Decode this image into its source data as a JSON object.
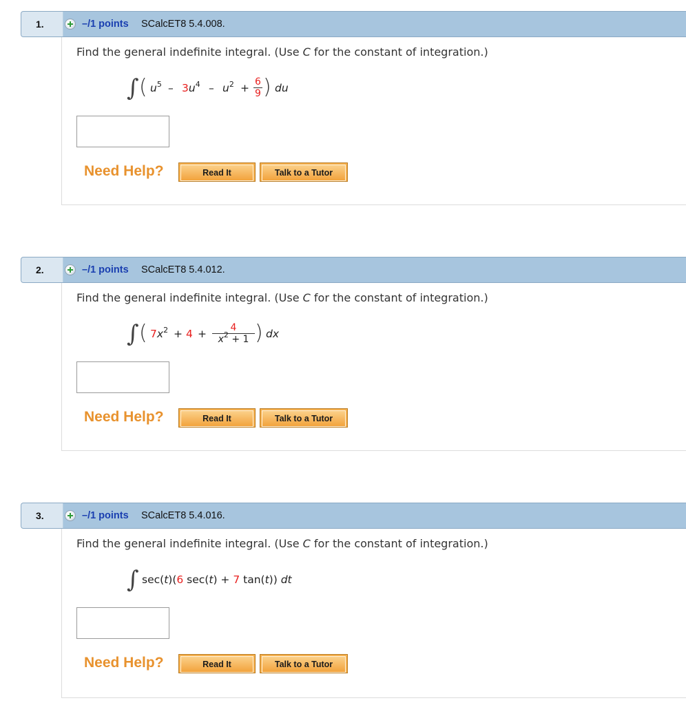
{
  "questions": [
    {
      "number": "1.",
      "points": "–/1 points",
      "code": "SCalcET8 5.4.008.",
      "prompt_before": "Find the general indefinite integral. (Use ",
      "prompt_var": "C",
      "prompt_after": " for the constant of integration.)",
      "math": {
        "t1_var": "u",
        "t1_exp": "5",
        "op1": "–",
        "t2_coef": "3",
        "t2_var": "u",
        "t2_exp": "4",
        "op2": "–",
        "t3_var": "u",
        "t3_exp": "2",
        "op3": "+",
        "frac_num": "6",
        "frac_den": "9",
        "differential": "du"
      },
      "need_help": "Need Help?",
      "read_it": "Read It",
      "talk_tutor": "Talk to a Tutor"
    },
    {
      "number": "2.",
      "points": "–/1 points",
      "code": "SCalcET8 5.4.012.",
      "prompt_before": "Find the general indefinite integral. (Use ",
      "prompt_var": "C",
      "prompt_after": " for the constant of integration.)",
      "math": {
        "t1_coef": "7",
        "t1_var": "x",
        "t1_exp": "2",
        "op1": "+",
        "t2_const": "4",
        "op2": "+",
        "frac_num": "4",
        "frac_den_var": "x",
        "frac_den_exp": "2",
        "frac_den_rest": " + 1",
        "differential": "dx"
      },
      "need_help": "Need Help?",
      "read_it": "Read It",
      "talk_tutor": "Talk to a Tutor"
    },
    {
      "number": "3.",
      "points": "–/1 points",
      "code": "SCalcET8 5.4.016.",
      "prompt_before": "Find the general indefinite integral. (Use ",
      "prompt_var": "C",
      "prompt_after": " for the constant of integration.)",
      "math": {
        "p1": "sec(",
        "v1": "t",
        "p2": ")(",
        "c1": "6",
        "p3": " sec(",
        "v2": "t",
        "p4": ") + ",
        "c2": "7",
        "p5": " tan(",
        "v3": "t",
        "p6": ")) ",
        "differential": "dt"
      },
      "need_help": "Need Help?",
      "read_it": "Read It",
      "talk_tutor": "Talk to a Tutor"
    }
  ],
  "colors": {
    "header_bg": "#a7c5de",
    "points_text": "#1a3fb0",
    "coefficient_red": "#e8201f",
    "help_orange": "#e8922e"
  }
}
